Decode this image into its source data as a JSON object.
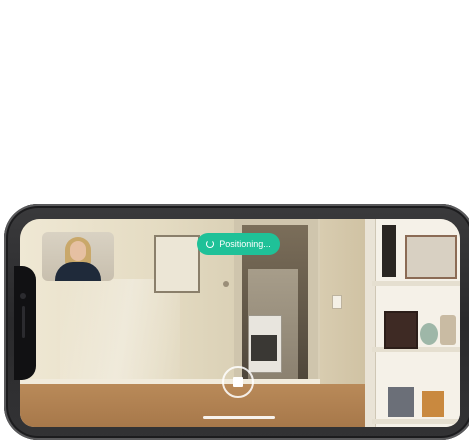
{
  "status": {
    "label": "Positioning..."
  },
  "controls": {
    "stop_icon": "stop-icon",
    "status_icon": "spinner-icon"
  },
  "colors": {
    "status_pill": "#1fc198",
    "phone_frame": "#2f2f31"
  }
}
